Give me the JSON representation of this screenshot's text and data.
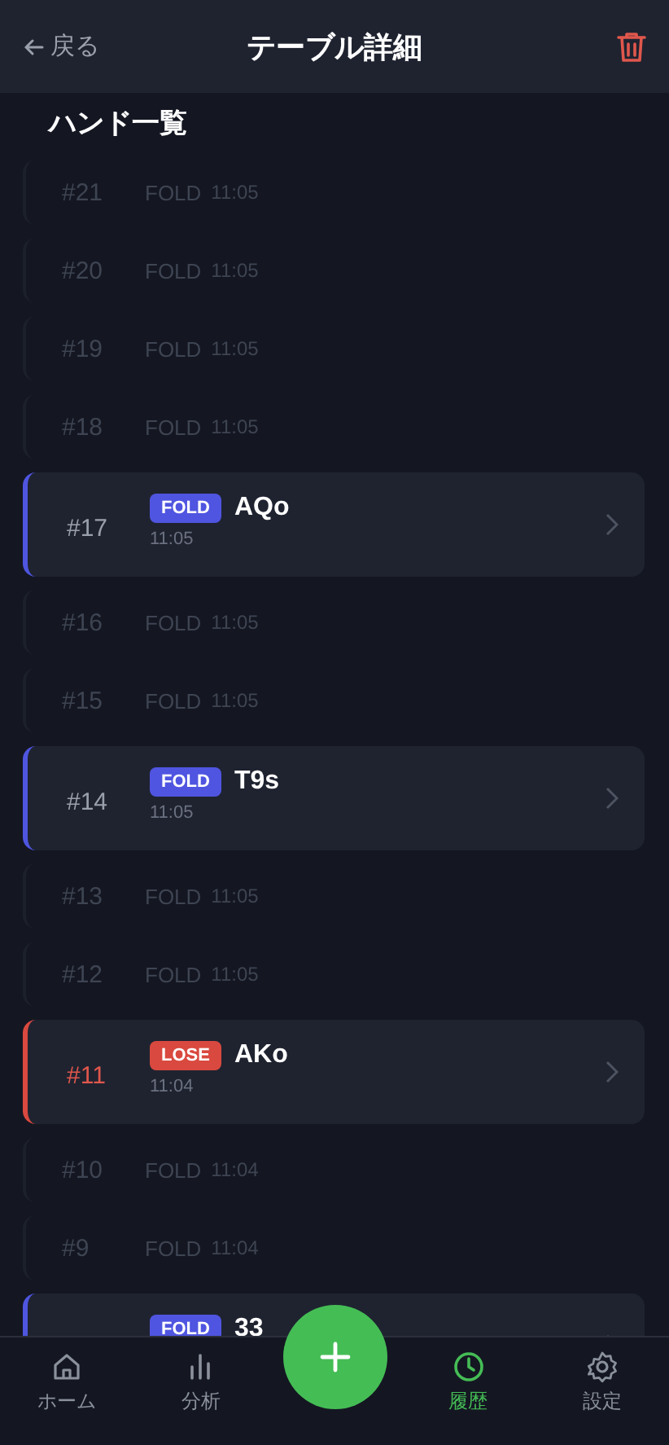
{
  "header": {
    "back": "戻る",
    "title": "テーブル詳細"
  },
  "section_title": "ハンド一覧",
  "hands": [
    {
      "kind": "compact",
      "number": "#21",
      "action": "FOLD",
      "time": "11:05"
    },
    {
      "kind": "compact",
      "number": "#20",
      "action": "FOLD",
      "time": "11:05"
    },
    {
      "kind": "compact",
      "number": "#19",
      "action": "FOLD",
      "time": "11:05"
    },
    {
      "kind": "compact",
      "number": "#18",
      "action": "FOLD",
      "time": "11:05"
    },
    {
      "kind": "detail",
      "color": "#4f55e0",
      "highlight": false,
      "number": "#17",
      "action": "FOLD",
      "hand": "AQo",
      "time": "11:05"
    },
    {
      "kind": "compact",
      "number": "#16",
      "action": "FOLD",
      "time": "11:05"
    },
    {
      "kind": "compact",
      "number": "#15",
      "action": "FOLD",
      "time": "11:05"
    },
    {
      "kind": "detail",
      "color": "#4f55e0",
      "highlight": false,
      "number": "#14",
      "action": "FOLD",
      "hand": "T9s",
      "time": "11:05"
    },
    {
      "kind": "compact",
      "number": "#13",
      "action": "FOLD",
      "time": "11:05"
    },
    {
      "kind": "compact",
      "number": "#12",
      "action": "FOLD",
      "time": "11:05"
    },
    {
      "kind": "detail",
      "color": "#d9493f",
      "highlight": true,
      "number": "#11",
      "action": "LOSE",
      "hand": "AKo",
      "time": "11:04"
    },
    {
      "kind": "compact",
      "number": "#10",
      "action": "FOLD",
      "time": "11:04"
    },
    {
      "kind": "compact",
      "number": "#9",
      "action": "FOLD",
      "time": "11:04"
    },
    {
      "kind": "detail",
      "color": "#4f55e0",
      "action": "FOLD",
      "hand": "33"
    }
  ],
  "nav": [
    {
      "kind": "home",
      "label": "ホーム",
      "selected": false
    },
    {
      "kind": "chart",
      "label": "分析",
      "selected": false
    },
    {
      "kind": "add"
    },
    {
      "kind": "history",
      "label": "履歴",
      "selected": true
    },
    {
      "kind": "settings",
      "label": "設定",
      "selected": false
    }
  ]
}
